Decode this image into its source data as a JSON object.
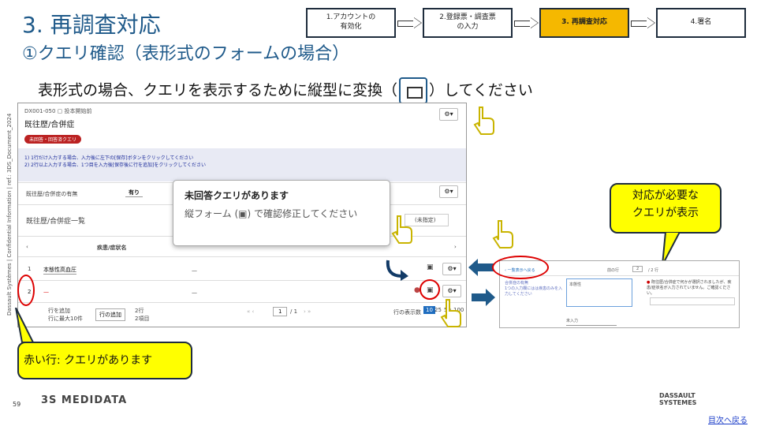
{
  "title_main": "3. 再調査対応",
  "title_sub": "①クエリ確認（表形式のフォームの場合）",
  "instruction_before": "表形式の場合、クエリを表示するために縦型に変換（",
  "instruction_after": "）してください",
  "steps": [
    {
      "label": "1.アカウントの\n有効化"
    },
    {
      "label": "2.登録票・調査票\nの入力"
    },
    {
      "label": "3. 再調査対応"
    },
    {
      "label": "4.署名"
    }
  ],
  "vertical_note": "Dassault Systèmes | Confidential Information | ref.: 3DS_Document_2024",
  "panel": {
    "breadcrumb": "DX001-050 ▢ 投本開始前",
    "form_title": "既往歴/合併症",
    "badge": "未回答・回答済クエリ",
    "notice_line1": "1) 1行だけ入力する場合、入力後に左下の[保存]ボタンをクリックしてください",
    "notice_line2": "2) 2行以上入力する場合、1つ目を入力後[保存後に行を追加]をクリックしてください",
    "field_label": "既往歴/合併症の有無",
    "field_value": "有り",
    "section_title": "既往歴/合併症一覧",
    "col_header": "疾患/症状名",
    "search_placeholder": "(未指定)",
    "row1_num": "1",
    "row1_value": "本態性高血圧",
    "row2_num": "2",
    "add_row_label": "行を追加",
    "add_row_note": "行に最大10件",
    "add_row_button": "行の追加",
    "count_rows": "2行",
    "count_items": "2項目",
    "page_num": "1",
    "page_total": "/ 1",
    "per_page_label": "行の表示数",
    "per_page_opts": [
      "10",
      "25",
      "50",
      "100"
    ]
  },
  "tooltip": {
    "title": "未回答クエリがあります",
    "body": "縦フォーム (▣) で確認修正してください"
  },
  "callout_right": "対応が必要な\nクエリが表示",
  "callout_left": "赤い行: クエリがあります",
  "second_panel": {
    "left_text": "合併症の有無\n1つの入力欄にはは疾患のみを入力してください",
    "input_value": "本態性",
    "query_text": "既往歴/合併症で何かが選択されましたが、疾患/症状名が入力されていません。ご確認ください。",
    "nav": "前の行",
    "page": "2",
    "of_rows": "/ 2 行",
    "select_value": "未入力"
  },
  "footer": {
    "page_number": "59",
    "logo": "3S MEDIDATA",
    "ds_logo": "DASSAULT\nSYSTEMES",
    "link": "目次へ戻る"
  }
}
